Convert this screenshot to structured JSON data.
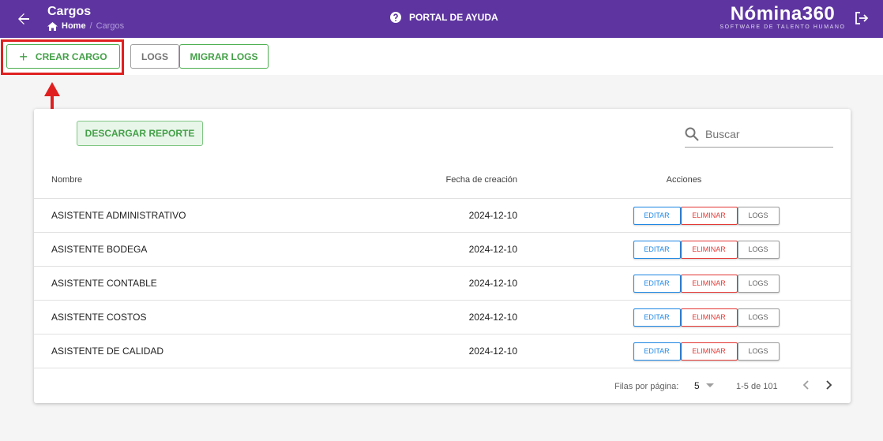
{
  "header": {
    "title": "Cargos",
    "breadcrumb": {
      "home": "Home",
      "current": "Cargos"
    },
    "help_label": "PORTAL DE AYUDA",
    "logo_main": "Nómina360",
    "logo_sub": "SOFTWARE DE TALENTO HUMANO"
  },
  "toolbar": {
    "crear_label": "CREAR CARGO",
    "logs_label": "LOGS",
    "migrar_label": "MIGRAR LOGS"
  },
  "card": {
    "descargar_label": "DESCARGAR REPORTE",
    "search_placeholder": "Buscar",
    "columns": {
      "name": "Nombre",
      "date": "Fecha de creación",
      "actions": "Acciones"
    },
    "rows": [
      {
        "name": "ASISTENTE ADMINISTRATIVO",
        "date": "2024-12-10"
      },
      {
        "name": "ASISTENTE BODEGA",
        "date": "2024-12-10"
      },
      {
        "name": "ASISTENTE CONTABLE",
        "date": "2024-12-10"
      },
      {
        "name": "ASISTENTE COSTOS",
        "date": "2024-12-10"
      },
      {
        "name": "ASISTENTE DE CALIDAD",
        "date": "2024-12-10"
      }
    ],
    "action_labels": {
      "edit": "EDITAR",
      "delete": "ELIMINAR",
      "logs": "LOGS"
    },
    "footer": {
      "rows_per_page_label": "Filas por página:",
      "rows_per_page_value": "5",
      "range": "1-5 de 101"
    }
  },
  "colors": {
    "header_bg": "#5e35a0",
    "green": "#43a047",
    "blue": "#1e88e5",
    "red": "#e53935",
    "highlight": "#e02020"
  }
}
